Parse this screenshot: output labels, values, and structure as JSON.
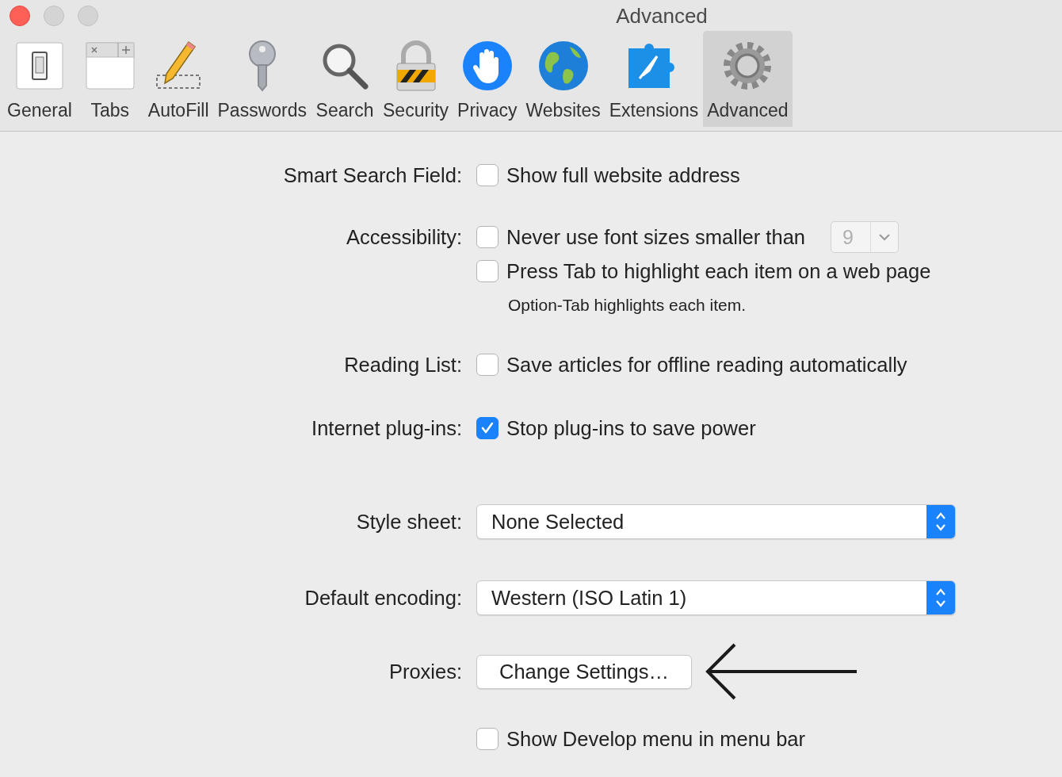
{
  "window": {
    "title": "Advanced"
  },
  "toolbar": [
    {
      "kind": "switch",
      "label": "General",
      "selected": false
    },
    {
      "kind": "tabs",
      "label": "Tabs",
      "selected": false
    },
    {
      "kind": "pencil",
      "label": "AutoFill",
      "selected": false
    },
    {
      "kind": "key",
      "label": "Passwords",
      "selected": false
    },
    {
      "kind": "magnifier",
      "label": "Search",
      "selected": false
    },
    {
      "kind": "lock",
      "label": "Security",
      "selected": false
    },
    {
      "kind": "hand",
      "label": "Privacy",
      "selected": false
    },
    {
      "kind": "globe",
      "label": "Websites",
      "selected": false
    },
    {
      "kind": "puzzle",
      "label": "Extensions",
      "selected": false
    },
    {
      "kind": "gear",
      "label": "Advanced",
      "selected": true
    }
  ],
  "settings": [
    {
      "kind": "checkboxes",
      "label": "Smart Search Field:",
      "options": [
        {
          "label": "Show full website address",
          "checked": false
        }
      ]
    },
    {
      "kind": "checkboxes",
      "label": "Accessibility:",
      "options": [
        {
          "label": "Never use font sizes smaller than",
          "checked": false,
          "font_size": {
            "value": "9",
            "disabled": true
          }
        },
        {
          "label": "Press Tab to highlight each item on a web page",
          "checked": false,
          "note": "Option-Tab highlights each item."
        }
      ]
    },
    {
      "kind": "checkboxes",
      "label": "Reading List:",
      "options": [
        {
          "label": "Save articles for offline reading automatically",
          "checked": false
        }
      ]
    },
    {
      "kind": "checkboxes",
      "label": "Internet plug-ins:",
      "options": [
        {
          "label": "Stop plug-ins to save power",
          "checked": true
        }
      ]
    },
    {
      "kind": "popup",
      "label": "Style sheet:",
      "value": "None Selected"
    },
    {
      "kind": "popup",
      "label": "Default encoding:",
      "value": "Western (ISO Latin 1)"
    },
    {
      "kind": "button",
      "label": "Proxies:",
      "button": "Change Settings…"
    },
    {
      "kind": "checkboxes",
      "options": [
        {
          "label": "Show Develop menu in menu bar",
          "checked": false
        }
      ]
    }
  ]
}
